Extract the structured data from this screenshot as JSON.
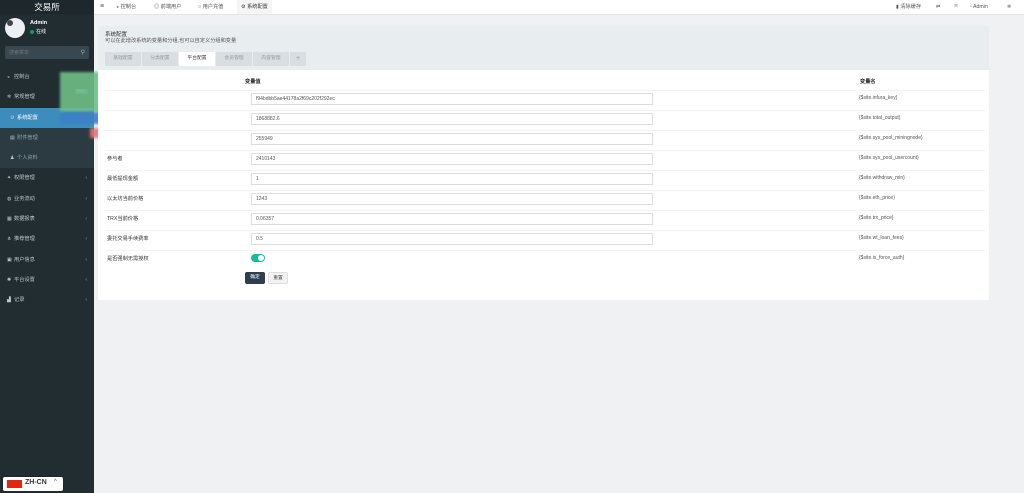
{
  "app": {
    "name": "交易所"
  },
  "user": {
    "name": "Admin",
    "status": "在线"
  },
  "search": {
    "placeholder": "搜索菜单"
  },
  "sidebar": {
    "items": [
      {
        "label": "控制台",
        "icon": "dashboard-icon"
      },
      {
        "label": "常规管理",
        "icon": "cogs-icon",
        "badge": "new"
      },
      {
        "label": "系统配置",
        "icon": "cog-icon"
      },
      {
        "label": "附件管理",
        "icon": "file-icon"
      },
      {
        "label": "个人资料",
        "icon": "user-icon"
      },
      {
        "label": "权限管理",
        "icon": "group-icon"
      },
      {
        "label": "业务流动",
        "icon": "globe-icon"
      },
      {
        "label": "数据报表",
        "icon": "table-icon"
      },
      {
        "label": "推荐管理",
        "icon": "share-icon"
      },
      {
        "label": "用户信息",
        "icon": "id-card-icon"
      },
      {
        "label": "平台设置",
        "icon": "gear-icon"
      },
      {
        "label": "记录",
        "icon": "chart-icon"
      }
    ]
  },
  "topbar": {
    "menu_icon": "≡",
    "tabs": [
      "控制台",
      "前端用户",
      "用户充值",
      "系统配置"
    ],
    "clear_cache": "清除缓存",
    "admin": "Admin"
  },
  "panel": {
    "title": "系统配置",
    "subtitle": "可以在此增改系统的变量和分组,也可以自定义分组和变量",
    "tabs": [
      "基础配置",
      "分类配置",
      "平台配置",
      "会员管理",
      "内容管理",
      "+"
    ],
    "col_value": "变量值",
    "col_name": "变量名"
  },
  "rows": [
    {
      "label": "",
      "value": "f94bdbb5ae44178a2f69c202f292ec",
      "name": "{$site.infura_key}"
    },
    {
      "label": "",
      "value": "1868882.6",
      "name": "{$site.total_output}"
    },
    {
      "label": "",
      "value": "255949",
      "name": "{$site.sys_pool_miningnode}"
    },
    {
      "label": "参与者",
      "value": "2410143",
      "name": "{$site.sys_pool_usercount}"
    },
    {
      "label": "最低提现金额",
      "value": "1",
      "name": "{$site.withdraw_min}"
    },
    {
      "label": "以太坊当前价格",
      "value": "1243",
      "name": "{$site.eth_price}"
    },
    {
      "label": "TRX当前价格",
      "value": "0.06357",
      "name": "{$site.trx_price}"
    },
    {
      "label": "委托交易手续费率",
      "value": "0.5",
      "name": "{$site.wt_loan_fees}"
    },
    {
      "label": "是否强制无需授权",
      "value": "",
      "name": "{$site.is_force_auth}",
      "toggle": true
    }
  ],
  "buttons": {
    "submit": "确定",
    "reset": "重置"
  },
  "lang": {
    "code": "ZH-CN",
    "arrow": "^"
  },
  "colors": {
    "sidebar": "#222d32",
    "accent": "#3c8dbc",
    "toggle": "#18bc9c",
    "primary_button": "#2c3e50"
  }
}
